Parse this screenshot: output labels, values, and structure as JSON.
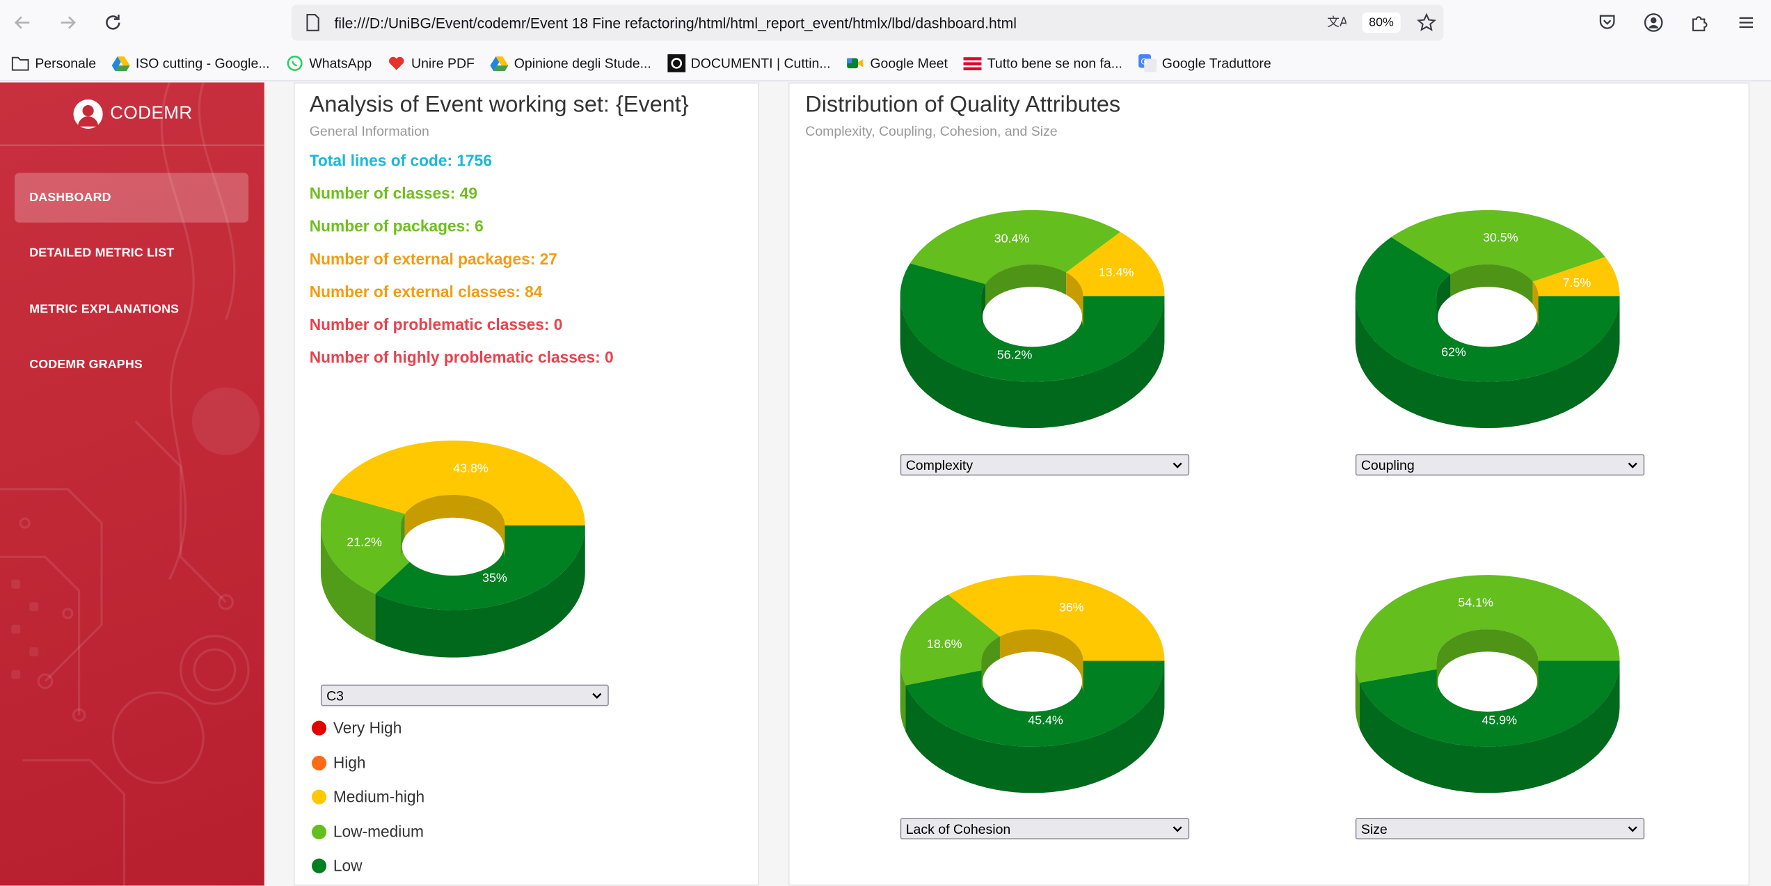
{
  "browser": {
    "url": "file:///D:/UniBG/Event/codemr/Event 18 Fine refactoring/html/html_report_event/htmlx/lbd/dashboard.html",
    "zoom": "80%",
    "bookmarks": [
      "Personale",
      "ISO cutting - Google...",
      "WhatsApp",
      "Unire PDF",
      "Opinione degli Stude...",
      "DOCUMENTI | Cuttin...",
      "Google Meet",
      "Tutto bene se non fa...",
      "Google Traduttore"
    ]
  },
  "sidebar": {
    "brand": "CODEMR",
    "items": [
      {
        "label": "DASHBOARD",
        "active": true
      },
      {
        "label": "DETAILED METRIC LIST",
        "active": false
      },
      {
        "label": "METRIC EXPLANATIONS",
        "active": false
      },
      {
        "label": "CODEMR GRAPHS",
        "active": false
      }
    ]
  },
  "analysis": {
    "title": "Analysis of Event working set: {Event}",
    "subtitle": "General Information",
    "lines": [
      {
        "text": "Total lines of code: 1756",
        "color": "#1ab8d8"
      },
      {
        "text": "Number of classes: 49",
        "color": "#6fbf1e"
      },
      {
        "text": "Number of packages: 6",
        "color": "#6fbf1e"
      },
      {
        "text": "Number of external packages: 27",
        "color": "#f39c12"
      },
      {
        "text": "Number of external classes: 84",
        "color": "#f39c12"
      },
      {
        "text": "Number of problematic classes: 0",
        "color": "#e8414e"
      },
      {
        "text": "Number of highly problematic classes: 0",
        "color": "#e8414e"
      }
    ],
    "select_value": "C3",
    "legend": [
      {
        "label": "Very High",
        "color": "#e00000"
      },
      {
        "label": "High",
        "color": "#ff6a13"
      },
      {
        "label": "Medium-high",
        "color": "#ffc800"
      },
      {
        "label": "Low-medium",
        "color": "#63be1e"
      },
      {
        "label": "Low",
        "color": "#008021"
      }
    ]
  },
  "distribution": {
    "title": "Distribution of Quality Attributes",
    "subtitle": "Complexity, Coupling, Cohesion, and Size"
  },
  "colors": {
    "low": "#008021",
    "low_medium": "#63be1e",
    "medium_high": "#ffc800"
  },
  "chart_data": [
    {
      "type": "pie",
      "select": "C3",
      "categories": [
        "Medium-high",
        "Low-medium",
        "Low"
      ],
      "values": [
        43.8,
        21.2,
        35
      ],
      "labels": [
        "43.8%",
        "21.2%",
        "35%"
      ]
    },
    {
      "type": "pie",
      "select": "Complexity",
      "categories": [
        "Medium-high",
        "Low-medium",
        "Low"
      ],
      "values": [
        13.4,
        30.4,
        56.2
      ],
      "labels": [
        "13.4%",
        "30.4%",
        "56.2%"
      ]
    },
    {
      "type": "pie",
      "select": "Coupling",
      "categories": [
        "Medium-high",
        "Low-medium",
        "Low"
      ],
      "values": [
        7.5,
        30.5,
        62
      ],
      "labels": [
        "7.5%",
        "30.5%",
        "62%"
      ]
    },
    {
      "type": "pie",
      "select": "Lack of Cohesion",
      "categories": [
        "Medium-high",
        "Low-medium",
        "Low"
      ],
      "values": [
        36,
        18.6,
        45.4
      ],
      "labels": [
        "36%",
        "18.6%",
        "45.4%"
      ]
    },
    {
      "type": "pie",
      "select": "Size",
      "categories": [
        "Low-medium",
        "Low"
      ],
      "values": [
        54.1,
        45.9
      ],
      "labels": [
        "54.1%",
        "45.9%"
      ]
    }
  ]
}
